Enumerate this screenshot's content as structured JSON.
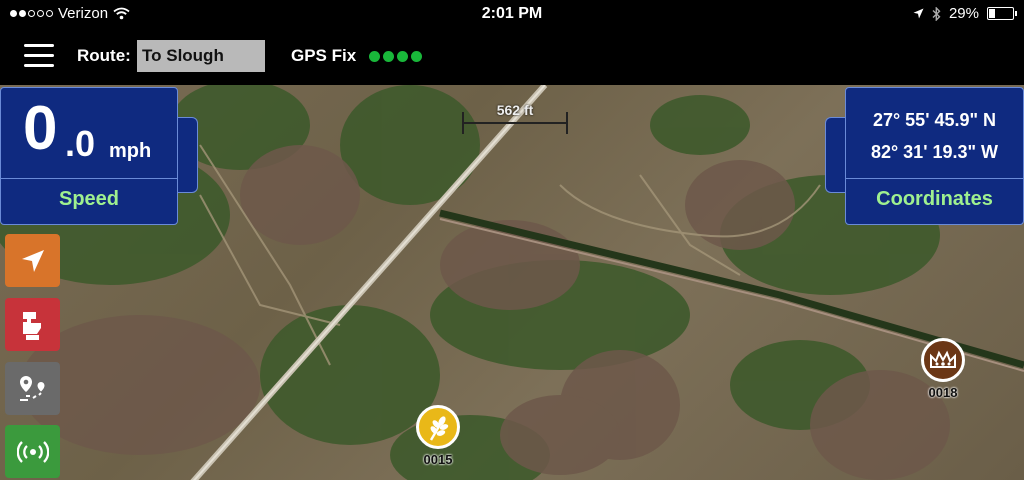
{
  "status_bar": {
    "carrier": "Verizon",
    "signal_bars_filled": 2,
    "signal_bars_total": 5,
    "time": "2:01 PM",
    "battery_percent": "29%",
    "battery_level": 0.29,
    "icons": [
      "wifi-icon",
      "location-arrow-icon",
      "bluetooth-icon",
      "battery-icon"
    ]
  },
  "header": {
    "menu_icon": "hamburger-menu-icon",
    "route_label": "Route:",
    "route_value": "To Slough",
    "gps_label": "GPS Fix",
    "gps_fix_dots": 4,
    "gps_color": "#19b73a"
  },
  "map": {
    "scale_label": "562 ft",
    "markers": [
      {
        "id": "0015",
        "icon": "wheat-icon",
        "color": "#e9b818"
      },
      {
        "id": "0018",
        "icon": "crown-icon",
        "color": "#6b3716"
      }
    ]
  },
  "speed_panel": {
    "whole": "0",
    "decimal": ".0",
    "unit": "mph",
    "caption": "Speed"
  },
  "coord_panel": {
    "latitude": "27° 55' 45.9\" N",
    "longitude": "82° 31' 19.3\" W",
    "caption": "Coordinates"
  },
  "side_buttons": [
    {
      "icon": "navigation-arrow-icon",
      "color": "#d8742a"
    },
    {
      "icon": "hand-sign-icon",
      "color": "#c7333a"
    },
    {
      "icon": "waypoints-icon",
      "color": "#6a6a6a"
    },
    {
      "icon": "broadcast-signal-icon",
      "color": "#3b9a3d"
    }
  ],
  "panel_color": "#0f2a80",
  "caption_color": "#9ff08f"
}
